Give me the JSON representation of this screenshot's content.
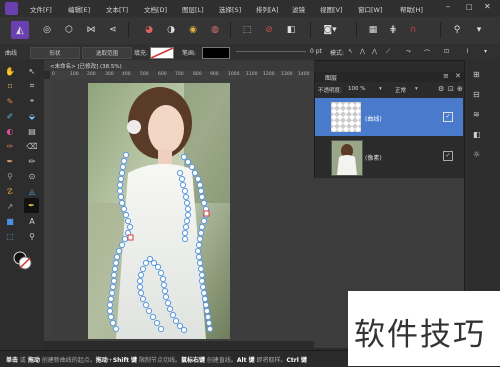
{
  "menu": [
    "文件[F]",
    "编辑[E]",
    "文本[T]",
    "文档[D]",
    "图层[L]",
    "选择[S]",
    "排列[A]",
    "滤镜",
    "视图[V]",
    "窗口[W]",
    "帮助[H]"
  ],
  "context": {
    "curve_label": "曲线",
    "shape_label": "形状",
    "selection_label": "选取范围",
    "fill_label": "填充:",
    "stroke_label": "笔画:",
    "stroke_width": "0 pt",
    "mode_label": "模式:"
  },
  "document": {
    "tab_title": "<未命名> [已修改] (38.5%)",
    "ruler_marks": [
      "0",
      "100",
      "200",
      "300",
      "400",
      "500",
      "600",
      "700",
      "800",
      "900",
      "1000",
      "1100",
      "1200",
      "1300",
      "1400"
    ]
  },
  "layers_panel": {
    "tab_title": "图层",
    "opacity_label": "不透明度:",
    "opacity_value": "100 %",
    "blend_mode": "正常",
    "layers": [
      {
        "name": "(曲线)"
      },
      {
        "name": "(像素)"
      }
    ]
  },
  "status": {
    "segments": [
      {
        "text": "单击",
        "bold": true
      },
      {
        "text": " 或 ",
        "bold": false
      },
      {
        "text": "拖动",
        "bold": true
      },
      {
        "text": " 创建新曲线的起点。",
        "bold": false
      },
      {
        "text": "拖动",
        "bold": true
      },
      {
        "text": "+",
        "bold": false
      },
      {
        "text": "Shift 键",
        "bold": true
      },
      {
        "text": " 限制节点切线。",
        "bold": false
      },
      {
        "text": "鼠标右键",
        "bold": true
      },
      {
        "text": " 创建直线。",
        "bold": false
      },
      {
        "text": "Alt 键",
        "bold": true
      },
      {
        "text": " 即将取样。",
        "bold": false
      },
      {
        "text": "Ctrl 键",
        "bold": true
      }
    ]
  },
  "watermark": "软件技巧",
  "colors": {
    "accent_purple": "#6a3fb0",
    "selected_layer": "#4a7acb",
    "node_blue": "#7fb0e6",
    "handle_red": "#d04040"
  }
}
